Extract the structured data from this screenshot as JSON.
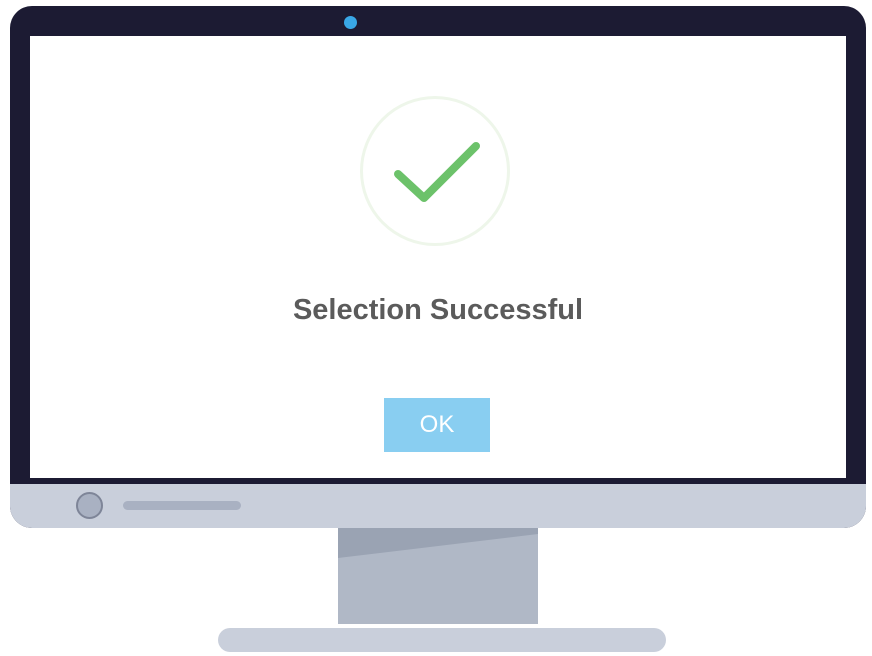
{
  "dialog": {
    "title": "Selection Successful",
    "ok_label": "OK",
    "icon": "checkmark-icon"
  },
  "colors": {
    "frame": "#1c1b33",
    "camera": "#39a7e6",
    "check": "#6cc26a",
    "button": "#89cef1",
    "title_text": "#5b5b5b"
  }
}
